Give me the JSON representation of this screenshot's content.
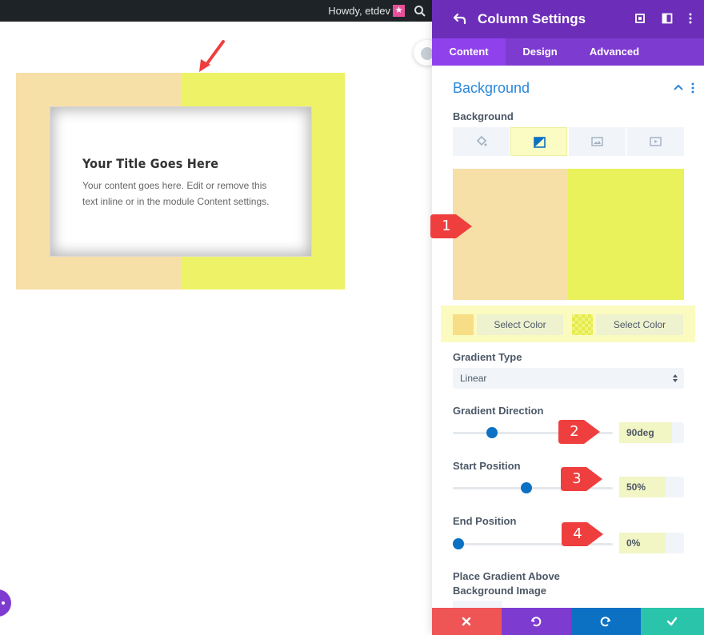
{
  "admin_bar": {
    "greeting": "Howdy, etdev"
  },
  "preview": {
    "title": "Your Title Goes Here",
    "body": "Your content goes here. Edit or remove this text inline or in the module Content settings."
  },
  "panel": {
    "title": "Column Settings",
    "tabs": [
      "Content",
      "Design",
      "Advanced"
    ],
    "active_tab": "Content",
    "section_title": "Background",
    "background_label": "Background",
    "background_types": [
      "color-icon",
      "gradient-icon",
      "image-icon",
      "video-icon"
    ],
    "gradient": {
      "color_1": "#f7dfa8",
      "color_2": "#e9f25b",
      "stop_buttons": [
        "Select Color",
        "Select Color"
      ]
    },
    "gradient_type_label": "Gradient Type",
    "gradient_type_value": "Linear",
    "gradient_direction_label": "Gradient Direction",
    "gradient_direction_value": "90deg",
    "start_position_label": "Start Position",
    "start_position_value": "50%",
    "end_position_label": "End Position",
    "end_position_value": "0%",
    "place_gradient_label_line1": "Place Gradient Above",
    "place_gradient_label_line2": "Background Image"
  },
  "callouts": [
    "1",
    "2",
    "3",
    "4"
  ],
  "colors": {
    "purple_dark": "#6c2eb9",
    "purple": "#7e3bd0",
    "accent_blue": "#2b87da",
    "footer_red": "#ef5555",
    "footer_purple": "#7e3bd0",
    "footer_blue": "#0c71c3",
    "footer_green": "#29c4a9",
    "callout_red": "#ef3e3e"
  }
}
